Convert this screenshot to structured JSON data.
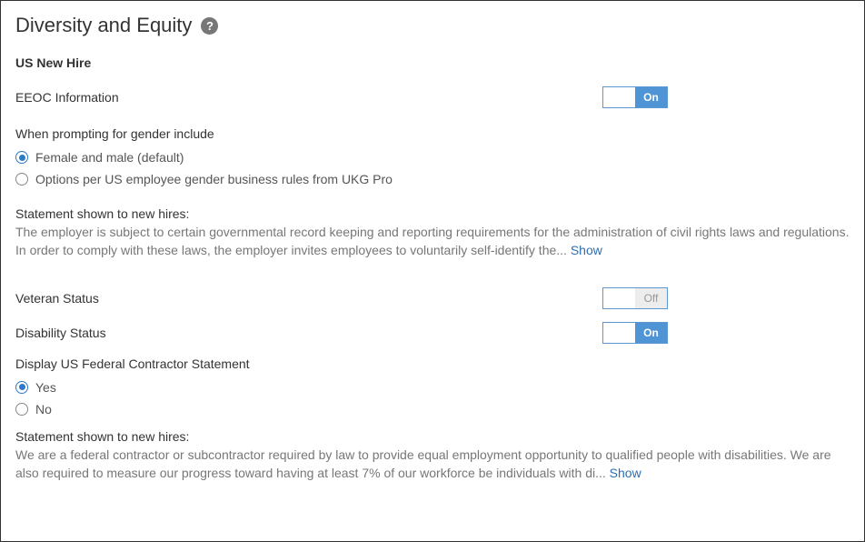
{
  "title": "Diversity and Equity",
  "section": "US New Hire",
  "eeoc": {
    "label": "EEOC Information",
    "toggle_state": "on",
    "toggle_on_text": "On",
    "toggle_off_text": ""
  },
  "gender_prompt": {
    "heading": "When prompting for gender include",
    "options": [
      {
        "label": "Female and male (default)",
        "checked": true
      },
      {
        "label": "Options per US employee gender business rules from UKG Pro",
        "checked": false
      }
    ]
  },
  "statement1": {
    "heading": "Statement shown to new hires:",
    "body": "The employer is subject to certain governmental record keeping and reporting requirements for the administration of civil rights laws and regulations. In order to comply with these laws, the employer invites employees to voluntarily self-identify the... ",
    "show": "Show"
  },
  "veteran": {
    "label": "Veteran Status",
    "toggle_state": "off",
    "toggle_on_text": "",
    "toggle_off_text": "Off"
  },
  "disability": {
    "label": "Disability Status",
    "toggle_state": "on",
    "toggle_on_text": "On",
    "toggle_off_text": ""
  },
  "contractor": {
    "heading": "Display US Federal Contractor Statement",
    "options": [
      {
        "label": "Yes",
        "checked": true
      },
      {
        "label": "No",
        "checked": false
      }
    ]
  },
  "statement2": {
    "heading": "Statement shown to new hires:",
    "body": "We are a federal contractor or subcontractor required by law to provide equal employment opportunity to qualified people with disabilities. We are also required to measure our progress toward having at least 7% of our workforce be individuals with di... ",
    "show": "Show"
  }
}
